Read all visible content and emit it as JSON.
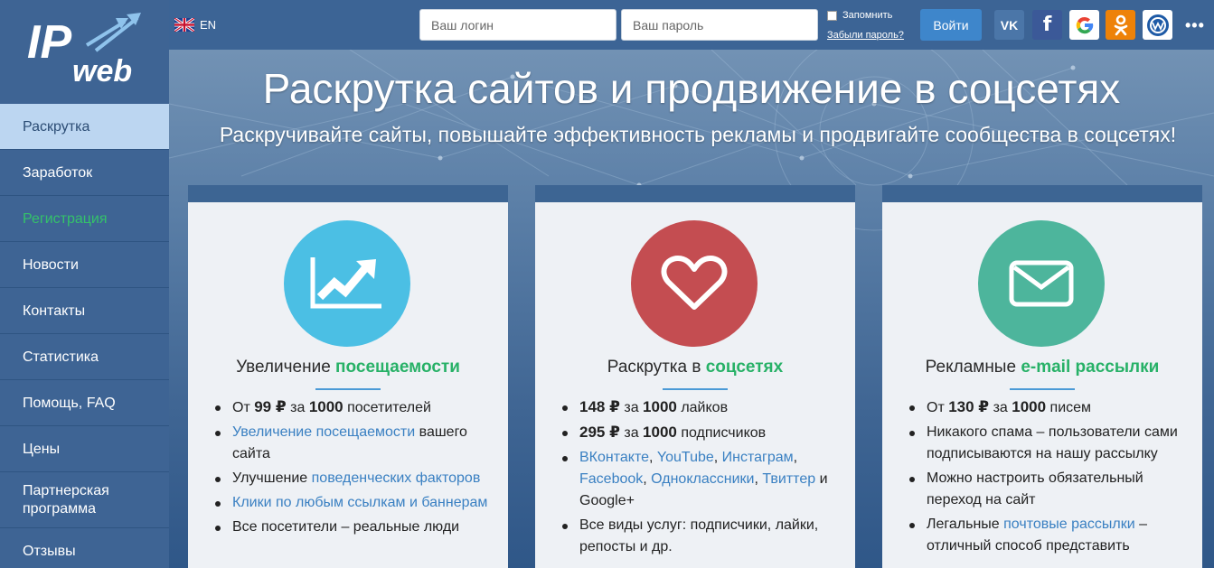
{
  "logo": {
    "text_ip": "IP",
    "text_web": "web"
  },
  "nav": [
    {
      "label": "Раскрутка",
      "state": "active"
    },
    {
      "label": "Заработок"
    },
    {
      "label": "Регистрация",
      "state": "green"
    },
    {
      "label": "Новости"
    },
    {
      "label": "Контакты"
    },
    {
      "label": "Статистика"
    },
    {
      "label": "Помощь, FAQ"
    },
    {
      "label": "Цены"
    },
    {
      "label": "Партнерская программа"
    },
    {
      "label": "Отзывы"
    }
  ],
  "header": {
    "lang": "EN",
    "login_placeholder": "Ваш логин",
    "password_placeholder": "Ваш пароль",
    "remember_label": "Запомнить",
    "forgot_label": "Забыли пароль?",
    "login_button": "Войти",
    "social_icons": [
      "vk-icon",
      "facebook-icon",
      "google-icon",
      "odnoklassniki-icon",
      "webmoney-icon"
    ],
    "vk_text": "VK",
    "fb_text": "f",
    "more": "•••"
  },
  "hero": {
    "title": "Раскрутка сайтов и продвижение в соцсетях",
    "subtitle": "Раскручивайте сайты, повышайте эффективность рекламы и продвигайте сообщества в соцсетях!"
  },
  "colors": {
    "accent_green": "#27b167",
    "link_blue": "#3a80c2",
    "circle_blue": "#4bbfe4",
    "circle_red": "#c44d51",
    "circle_green": "#4db59c"
  },
  "cards": [
    {
      "icon": "chart-growth-icon",
      "title_plain": "Увеличение ",
      "title_highlight": "посещаемости",
      "items": [
        {
          "t1": "От ",
          "b1": "99 ₽",
          "t2": " за ",
          "b2": "1000",
          "t3": " посетителей"
        },
        {
          "link": "Увеличение посещаемости",
          "t4": " вашего сайта"
        },
        {
          "t1": "Улучшение ",
          "link": "поведенческих факторов"
        },
        {
          "link": "Клики по любым ссылкам и баннерам"
        },
        {
          "t1": "Все посетители – реальные люди"
        }
      ]
    },
    {
      "icon": "heart-icon",
      "title_plain": "Раскрутка в ",
      "title_highlight": "соцсетях",
      "items": [
        {
          "b1": "148 ₽",
          "t2": " за ",
          "b2": "1000",
          "t3": " лайков"
        },
        {
          "b1": "295 ₽",
          "t2": " за ",
          "b2": "1000",
          "t3": " подписчиков"
        },
        {
          "l1": "ВКонтакте",
          "s1": ", ",
          "l2": "YouTube",
          "s2": ", ",
          "l3": "Инстаграм",
          "s3": ", ",
          "l4": "Facebook",
          "s4": ", ",
          "l5": "Одноклассники",
          "s5": ", ",
          "l6": "Твиттер",
          "s6": " и Google+"
        },
        {
          "t1": "Все виды услуг: подписчики, лайки, репосты и др."
        }
      ]
    },
    {
      "icon": "envelope-icon",
      "title_plain": "Рекламные ",
      "title_highlight": "e-mail рассылки",
      "items": [
        {
          "t1": "От ",
          "b1": "130 ₽",
          "t2": " за ",
          "b2": "1000",
          "t3": " писем"
        },
        {
          "t1": "Никакого спама – пользователи сами подписываются на нашу рассылку"
        },
        {
          "t1": "Можно настроить обязательный переход на сайт"
        },
        {
          "t1": "Легальные ",
          "link": "почтовые рассылки",
          "t4": " – отличный способ представить"
        }
      ]
    }
  ]
}
